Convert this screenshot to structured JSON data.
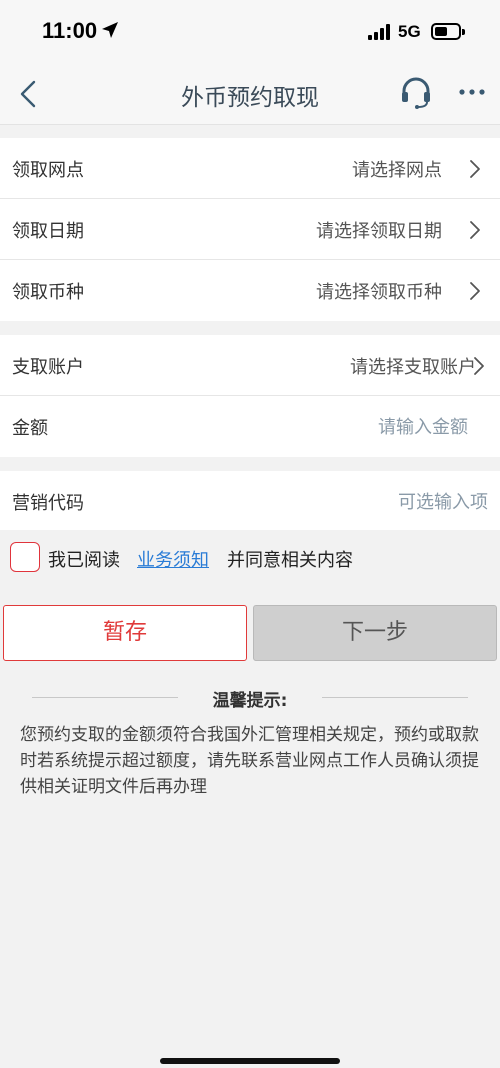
{
  "status_bar": {
    "time": "11:00",
    "network": "5G",
    "icons": [
      "location-arrow-icon",
      "signal-icon",
      "battery-icon"
    ]
  },
  "nav": {
    "title": "外币预约取现",
    "icons": [
      "back-chevron-icon",
      "headset-icon",
      "more-dots-icon"
    ]
  },
  "pickup": {
    "rows": [
      {
        "label": "领取网点",
        "value": "请选择网点"
      },
      {
        "label": "领取日期",
        "value": "请选择领取日期"
      },
      {
        "label": "领取币种",
        "value": "请选择领取币种"
      }
    ]
  },
  "account": {
    "account_label": "支取账户",
    "account_value": "请选择支取账户",
    "amount_label": "金额",
    "amount_placeholder": "请输入金额"
  },
  "marketing": {
    "label": "营销代码",
    "placeholder": "可选输入项"
  },
  "agreement": {
    "prefix": "我已阅读",
    "link": "业务须知",
    "suffix": "并同意相关内容"
  },
  "buttons": {
    "save": "暂存",
    "next": "下一步"
  },
  "tips": {
    "title": "温馨提示:",
    "body": "您预约支取的金额须符合我国外汇管理相关规定，预约或取款时若系统提示超过额度，请先联系营业网点工作人员确认须提供相关证明文件后再办理"
  },
  "colors": {
    "accent_red": "#e03a3a",
    "link_blue": "#2a7cd6",
    "title_text": "#3a4a58",
    "disabled_button": "#cfcfcf"
  }
}
